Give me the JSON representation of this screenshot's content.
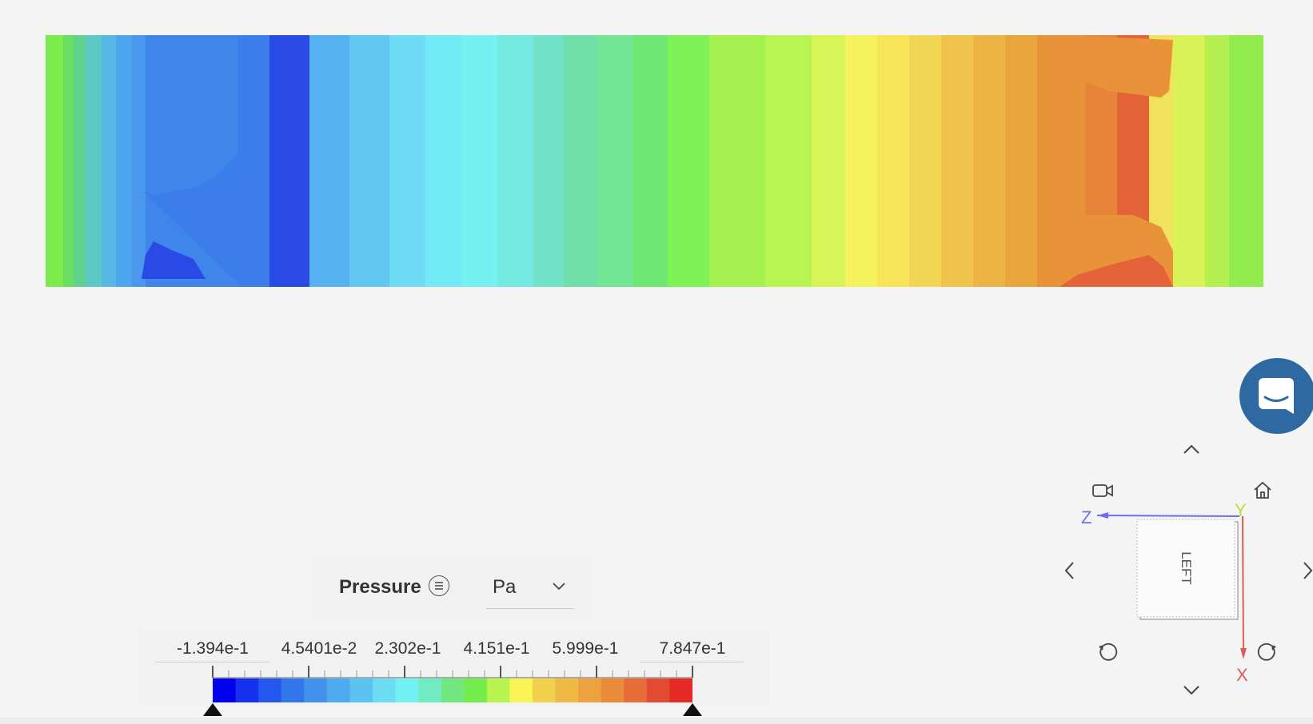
{
  "plot": {
    "colors": [
      "#7ceb4c",
      "#6cdd63",
      "#5fd28c",
      "#5cc9c5",
      "#57b8e8",
      "#4da7f0",
      "#4a98ee",
      "#3f85ea",
      "#3b7dea",
      "#2a4ae6",
      "#56b1f0",
      "#62c8f2",
      "#6fdcf6",
      "#71eaf5",
      "#76f1f2",
      "#74eae0",
      "#72e3c8",
      "#70dfa8",
      "#72e695",
      "#6fe873",
      "#7ef257",
      "#a4f04f",
      "#b8f552",
      "#d9f456",
      "#f6f25e",
      "#f6e657",
      "#f2d552",
      "#efc34c",
      "#ecb444",
      "#e9a53c",
      "#e8923a",
      "#e8833a",
      "#e46339",
      "#f0e25a",
      "#d9f255",
      "#b3f050",
      "#93ec4d"
    ],
    "high_pressure_color": "#e8923a",
    "low_pressure_color": "#3f85ea"
  },
  "legend": {
    "title": "Pressure",
    "menu_icon": "list-circle-icon",
    "unit": "Pa",
    "tick_labels": [
      "-1.394e-1",
      "4.5401e-2",
      "2.302e-1",
      "4.151e-1",
      "5.999e-1",
      "7.847e-1"
    ],
    "scale_colors": [
      "#0000ee",
      "#1530ee",
      "#2457ee",
      "#3375ec",
      "#4292ec",
      "#50aaef",
      "#5cc2f0",
      "#6cdcf4",
      "#72f0f2",
      "#73ebc2",
      "#73e77f",
      "#74ec4e",
      "#b9f34f",
      "#f8f454",
      "#f2d04c",
      "#efb945",
      "#eba23f",
      "#e88c3a",
      "#e66c38",
      "#e44a33",
      "#e52a25"
    ]
  },
  "chat": {
    "icon": "chat-bubble-icon",
    "color": "#2e6aa1"
  },
  "viewcube": {
    "face_label": "LEFT",
    "axes": {
      "x": "X",
      "y": "Y",
      "z": "Z"
    },
    "axis_colors": {
      "x": "#e25b5b",
      "y": "#b8e042",
      "z": "#6e6ef0"
    }
  }
}
